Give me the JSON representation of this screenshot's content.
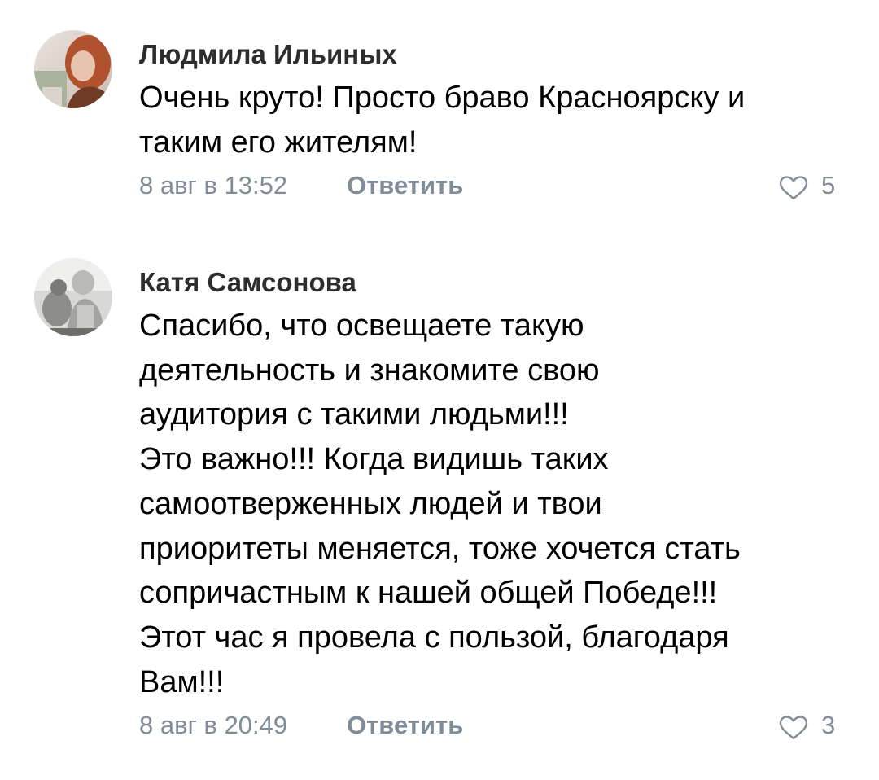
{
  "comments": [
    {
      "author": "Людмила Ильиных",
      "text_lines": [
        "Очень круто! Просто браво Красноярску и",
        "таким его жителям!"
      ],
      "date": "8 авг в 13:52",
      "reply_label": "Ответить",
      "likes": "5",
      "like_icon": "heart-outline-icon"
    },
    {
      "author": "Катя Самсонова",
      "text_lines": [
        "Спасибо, что освещаете такую",
        "деятельность и знакомите свою",
        "аудитория с такими людьми!!!",
        "Это важно!!! Когда видишь таких",
        "самоотверженных людей и твои",
        "приоритеты меняется, тоже хочется стать",
        "сопричастным к нашей общей Победе!!!",
        "Этот час я провела с пользой, благодаря",
        "Вам!!!"
      ],
      "date": "8 авг в 20:49",
      "reply_label": "Ответить",
      "likes": "3",
      "like_icon": "heart-outline-icon"
    }
  ],
  "colors": {
    "secondary_text": "#818c99",
    "author_text": "#2c2d2e",
    "body_text": "#000000",
    "background": "#ffffff"
  }
}
